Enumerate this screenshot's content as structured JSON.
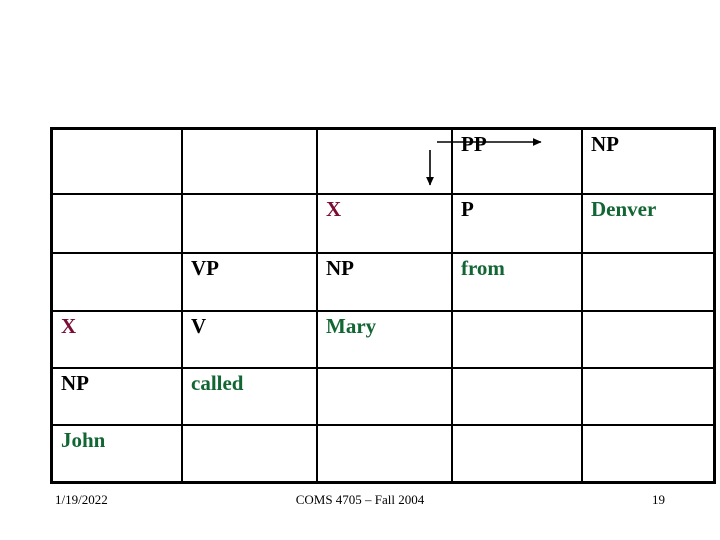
{
  "slide": {
    "colors": {
      "nonterminal_black": "#000000",
      "terminal_green": "#116633",
      "variable_maroon": "#7b0c35",
      "border": "#000000",
      "background": "#ffffff"
    }
  },
  "chart": {
    "columns": 5,
    "rows": 6,
    "cells": [
      [
        {
          "text": "",
          "color": "black"
        },
        {
          "text": "",
          "color": "black"
        },
        {
          "text": "",
          "color": "black"
        },
        {
          "text": "PP",
          "color": "black"
        },
        {
          "text": "NP",
          "color": "black"
        }
      ],
      [
        {
          "text": "",
          "color": "black"
        },
        {
          "text": "",
          "color": "black"
        },
        {
          "text": "X",
          "color": "maroon"
        },
        {
          "text": "P",
          "color": "black"
        },
        {
          "text": "Denver",
          "color": "green"
        }
      ],
      [
        {
          "text": "",
          "color": "black"
        },
        {
          "text": "VP",
          "color": "black"
        },
        {
          "text": "NP",
          "color": "black"
        },
        {
          "text": "from",
          "color": "green"
        },
        {
          "text": "",
          "color": "black"
        }
      ],
      [
        {
          "text": "X",
          "color": "maroon"
        },
        {
          "text": "V",
          "color": "black"
        },
        {
          "text": "Mary",
          "color": "green"
        },
        {
          "text": "",
          "color": "black"
        },
        {
          "text": "",
          "color": "black"
        }
      ],
      [
        {
          "text": "NP",
          "color": "black"
        },
        {
          "text": "called",
          "color": "green"
        },
        {
          "text": "",
          "color": "black"
        },
        {
          "text": "",
          "color": "black"
        },
        {
          "text": "",
          "color": "black"
        }
      ],
      [
        {
          "text": "John",
          "color": "green"
        },
        {
          "text": "",
          "color": "black"
        },
        {
          "text": "",
          "color": "black"
        },
        {
          "text": "",
          "color": "black"
        },
        {
          "text": "",
          "color": "black"
        }
      ]
    ],
    "annotations": [
      {
        "name": "pp-to-np-arrow",
        "from": "PP",
        "to": "NP",
        "direction": "right"
      },
      {
        "name": "pp-to-p-arrow",
        "from": "PP",
        "to": "P",
        "direction": "down"
      }
    ]
  },
  "footer": {
    "date": "1/19/2022",
    "course": "COMS 4705 – Fall 2004",
    "page": "19"
  }
}
